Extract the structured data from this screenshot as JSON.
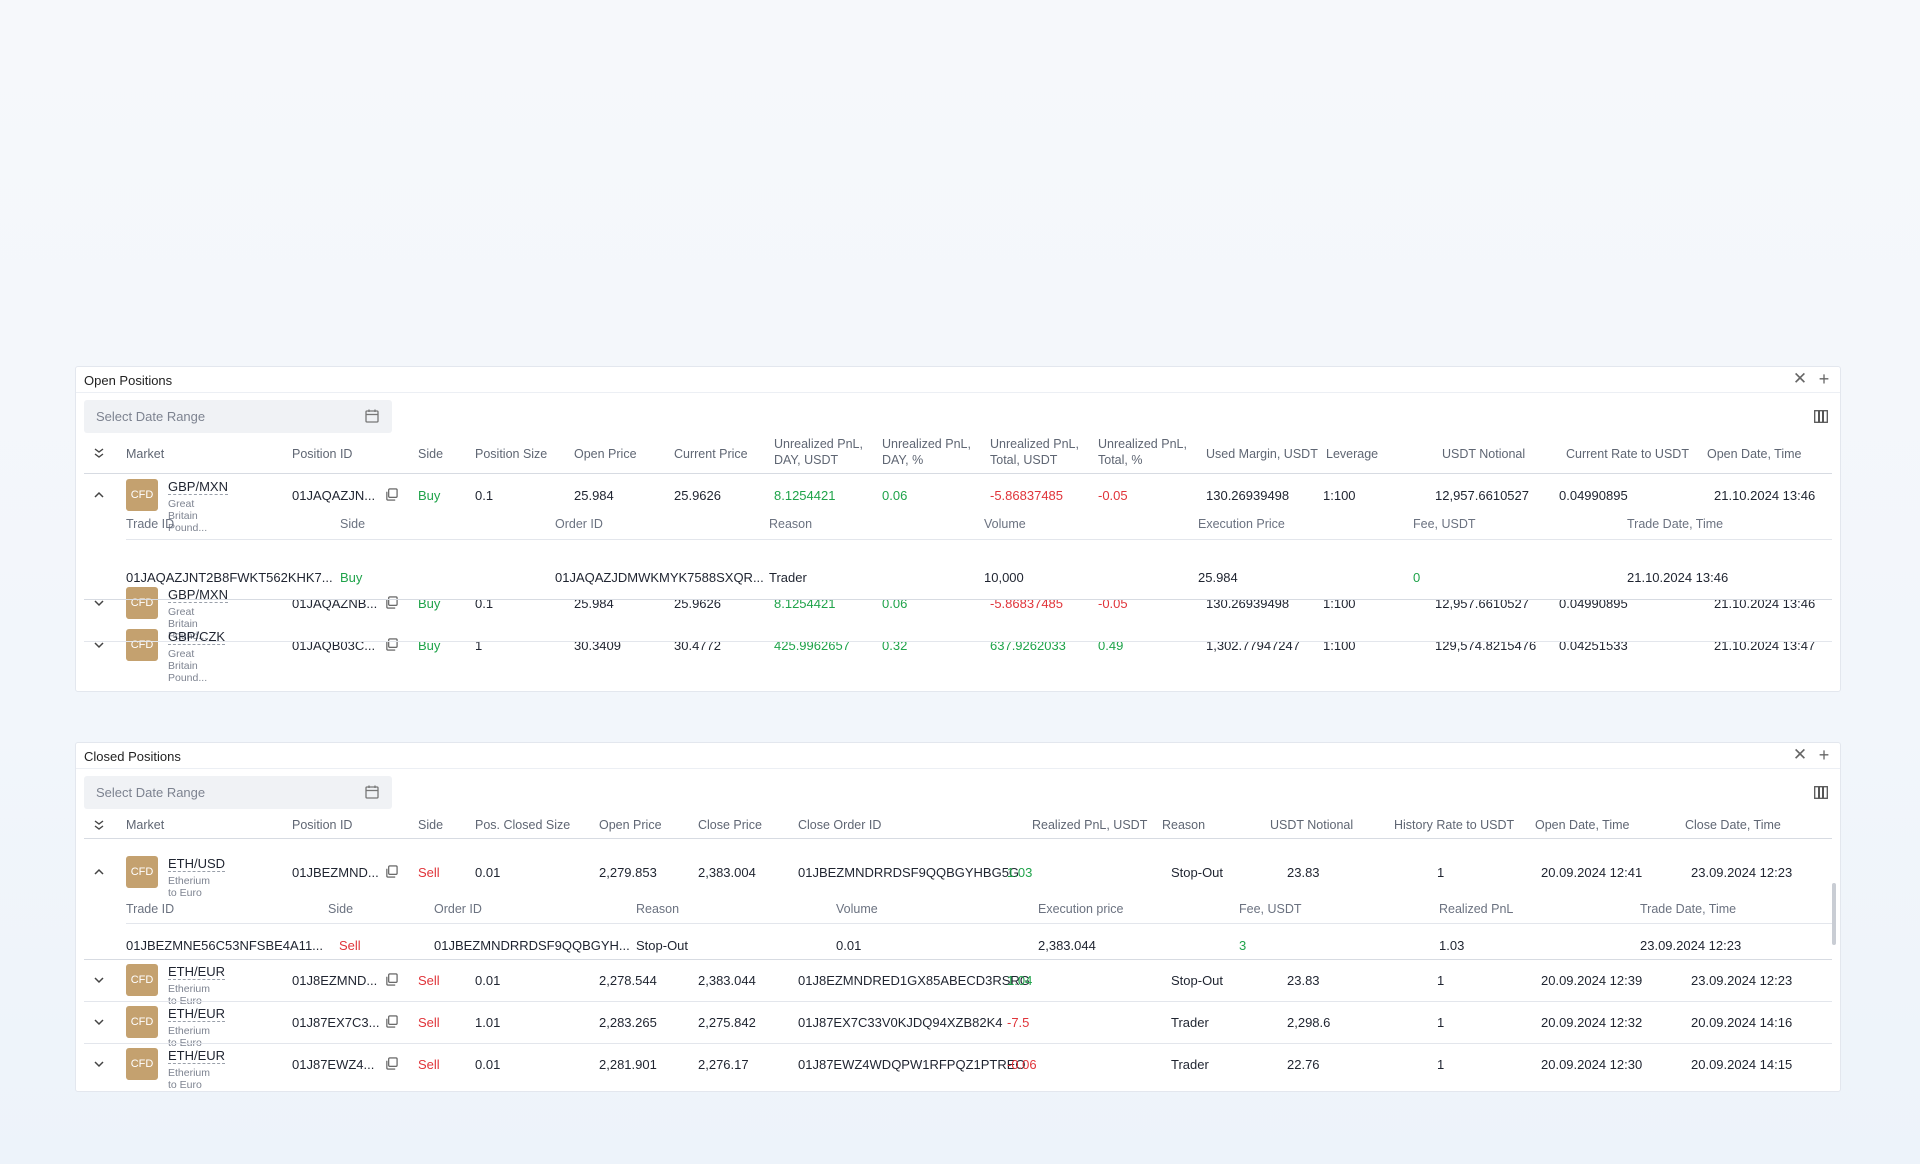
{
  "open_positions": {
    "title": "Open Positions",
    "date_placeholder": "Select Date Range",
    "headers": {
      "market": "Market",
      "position_id": "Position ID",
      "side": "Side",
      "position_size": "Position Size",
      "open_price": "Open Price",
      "current_price": "Current Price",
      "upnl_day_usdt": [
        "Unrealized PnL,",
        "DAY, USDT"
      ],
      "upnl_day_pct": [
        "Unrealized PnL,",
        "DAY, %"
      ],
      "upnl_total_usdt": [
        "Unrealized PnL,",
        "Total, USDT"
      ],
      "upnl_total_pct": [
        "Unrealized PnL,",
        "Total, %"
      ],
      "used_margin": "Used Margin, USDT",
      "leverage": "Leverage",
      "usdt_notional": "USDT Notional",
      "current_rate": "Current Rate to USDT",
      "open_date": "Open Date, Time"
    },
    "rows": [
      {
        "badge": "CFD",
        "market": "GBP/MXN",
        "desc": "Great Britain Pound...",
        "position_id": "01JAQAZJN...",
        "side": "Buy",
        "size": "0.1",
        "open_price": "25.984",
        "current_price": "25.9626",
        "upnl_day_usdt": "8.1254421",
        "upnl_day_pct": "0.06",
        "upnl_total_usdt": "-5.86837485",
        "upnl_total_pct": "-0.05",
        "used_margin": "130.26939498",
        "leverage": "1:100",
        "notional": "12,957.6610527",
        "rate": "0.04990895",
        "open_date": "21.10.2024 13:46",
        "expanded": true
      },
      {
        "badge": "CFD",
        "market": "GBP/MXN",
        "desc": "Great Britain Pound...",
        "position_id": "01JAQAZNB...",
        "side": "Buy",
        "size": "0.1",
        "open_price": "25.984",
        "current_price": "25.9626",
        "upnl_day_usdt": "8.1254421",
        "upnl_day_pct": "0.06",
        "upnl_total_usdt": "-5.86837485",
        "upnl_total_pct": "-0.05",
        "used_margin": "130.26939498",
        "leverage": "1:100",
        "notional": "12,957.6610527",
        "rate": "0.04990895",
        "open_date": "21.10.2024 13:46",
        "expanded": false
      },
      {
        "badge": "CFD",
        "market": "GBP/CZK",
        "desc": "Great Britain Pound...",
        "position_id": "01JAQB03C...",
        "side": "Buy",
        "size": "1",
        "open_price": "30.3409",
        "current_price": "30.4772",
        "upnl_day_usdt": "425.9962657",
        "upnl_day_pct": "0.32",
        "upnl_total_usdt": "637.9262033",
        "upnl_total_pct": "0.49",
        "used_margin": "1,302.77947247",
        "leverage": "1:100",
        "notional": "129,574.8215476",
        "rate": "0.04251533",
        "open_date": "21.10.2024 13:47",
        "expanded": false
      }
    ],
    "trade_headers": {
      "trade_id": "Trade ID",
      "side": "Side",
      "order_id": "Order ID",
      "reason": "Reason",
      "volume": "Volume",
      "exec_price": "Execution Price",
      "fee": "Fee, USDT",
      "trade_date": "Trade Date, Time"
    },
    "trade": {
      "trade_id": "01JAQAZJNT2B8FWKT562KHK7...",
      "side": "Buy",
      "order_id": "01JAQAZJDMWKMYK7588SXQR...",
      "reason": "Trader",
      "volume": "10,000",
      "exec_price": "25.984",
      "fee": "0",
      "trade_date": "21.10.2024 13:46"
    }
  },
  "closed_positions": {
    "title": "Closed Positions",
    "date_placeholder": "Select Date Range",
    "headers": {
      "market": "Market",
      "position_id": "Position ID",
      "side": "Side",
      "closed_size": "Pos. Closed Size",
      "open_price": "Open Price",
      "close_price": "Close Price",
      "close_order_id": "Close Order ID",
      "realized_pnl": "Realized PnL, USDT",
      "reason": "Reason",
      "usdt_notional": "USDT Notional",
      "history_rate": "History Rate to USDT",
      "open_date": "Open Date, Time",
      "close_date": "Close Date, Time"
    },
    "rows": [
      {
        "badge": "CFD",
        "market": "ETH/USD",
        "desc": "Etherium to Euro",
        "position_id": "01JBEZMND...",
        "side": "Sell",
        "size": "0.01",
        "open_price": "2,279.853",
        "close_price": "2,383.004",
        "close_order_id": "01JBEZMNDRRDSF9QQBGYHBG5G",
        "pnl": "1.03",
        "pnl_sign": "pos",
        "reason": "Stop-Out",
        "notional": "23.83",
        "rate": "1",
        "open_date": "20.09.2024 12:41",
        "close_date": "23.09.2024 12:23",
        "expanded": true
      },
      {
        "badge": "CFD",
        "market": "ETH/EUR",
        "desc": "Etherium to Euro",
        "position_id": "01J8EZMND...",
        "side": "Sell",
        "size": "0.01",
        "open_price": "2,278.544",
        "close_price": "2,383.044",
        "close_order_id": "01J8EZMNDRED1GX85ABECD3RSRG",
        "pnl": "1.04",
        "pnl_sign": "pos",
        "reason": "Stop-Out",
        "notional": "23.83",
        "rate": "1",
        "open_date": "20.09.2024 12:39",
        "close_date": "23.09.2024 12:23",
        "expanded": false
      },
      {
        "badge": "CFD",
        "market": "ETH/EUR",
        "desc": "Etherium to Euro",
        "position_id": "01J87EX7C3...",
        "side": "Sell",
        "size": "1.01",
        "open_price": "2,283.265",
        "close_price": "2,275.842",
        "close_order_id": "01J87EX7C33V0KJDQ94XZB82K4",
        "pnl": "-7.5",
        "pnl_sign": "neg",
        "reason": "Trader",
        "notional": "2,298.6",
        "rate": "1",
        "open_date": "20.09.2024 12:32",
        "close_date": "20.09.2024 14:16",
        "expanded": false
      },
      {
        "badge": "CFD",
        "market": "ETH/EUR",
        "desc": "Etherium to Euro",
        "position_id": "01J87EWZ4...",
        "side": "Sell",
        "size": "0.01",
        "open_price": "2,281.901",
        "close_price": "2,276.17",
        "close_order_id": "01J87EWZ4WDQPW1RFPQZ1PTREO",
        "pnl": "-0.06",
        "pnl_sign": "neg",
        "reason": "Trader",
        "notional": "22.76",
        "rate": "1",
        "open_date": "20.09.2024 12:30",
        "close_date": "20.09.2024 14:15",
        "expanded": false
      }
    ],
    "trade_headers": {
      "trade_id": "Trade ID",
      "side": "Side",
      "order_id": "Order ID",
      "reason": "Reason",
      "volume": "Volume",
      "exec_price": "Execution price",
      "fee": "Fee, USDT",
      "realized_pnl": "Realized PnL",
      "trade_date": "Trade Date, Time"
    },
    "trade": {
      "trade_id": "01JBEZMNE56C53NFSBE4A11...",
      "side": "Sell",
      "order_id": "01JBEZMNDRRDSF9QQBGYH...",
      "reason": "Stop-Out",
      "volume": "0.01",
      "exec_price": "2,383.044",
      "fee": "3",
      "realized_pnl": "1.03",
      "trade_date": "23.09.2024 12:23"
    }
  },
  "colors": {
    "positive": "#1fa34a",
    "negative": "#e0343a",
    "badge": "#c4a16f"
  },
  "icons": [
    "close-icon",
    "plus-icon",
    "calendar-icon",
    "columns-icon",
    "collapse-all-icon",
    "chevron-up-icon",
    "chevron-down-icon",
    "copy-icon"
  ]
}
